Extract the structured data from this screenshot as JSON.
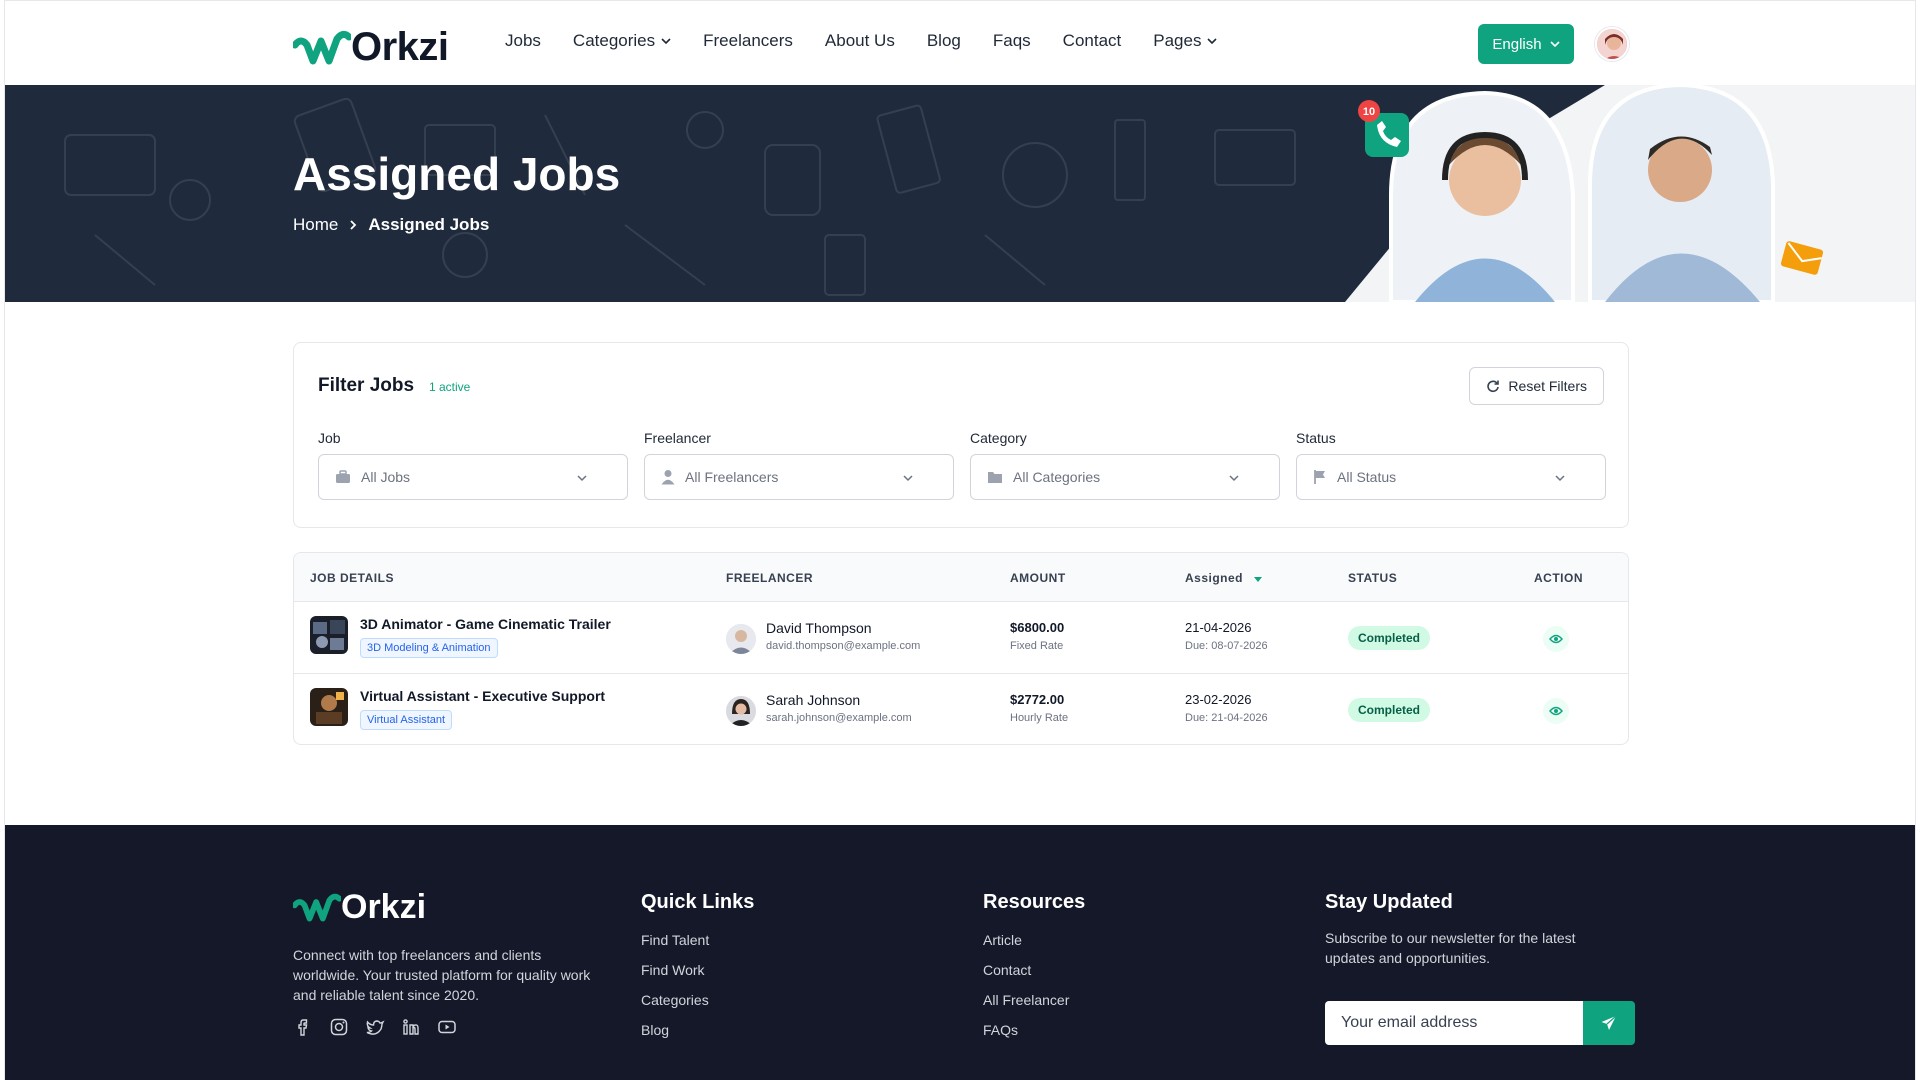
{
  "brand": {
    "logo_text": "Orkzi",
    "accent": "#10a37f",
    "dark_bg": "#1f2a3c",
    "footer_bg": "#141829"
  },
  "nav": {
    "items": [
      {
        "label": "Jobs",
        "dropdown": false
      },
      {
        "label": "Categories",
        "dropdown": true
      },
      {
        "label": "Freelancers",
        "dropdown": false
      },
      {
        "label": "About Us",
        "dropdown": false
      },
      {
        "label": "Blog",
        "dropdown": false
      },
      {
        "label": "Faqs",
        "dropdown": false
      },
      {
        "label": "Contact",
        "dropdown": false
      },
      {
        "label": "Pages",
        "dropdown": true
      }
    ],
    "language": "English"
  },
  "hero": {
    "title": "Assigned Jobs",
    "breadcrumb": {
      "home": "Home",
      "current": "Assigned Jobs"
    },
    "notification_count": "10"
  },
  "filters": {
    "title": "Filter Jobs",
    "active_count": "1 active",
    "reset_label": "Reset Filters",
    "fields": [
      {
        "label": "Job",
        "value": "All Jobs",
        "icon": "briefcase-icon"
      },
      {
        "label": "Freelancer",
        "value": "All Freelancers",
        "icon": "user-icon"
      },
      {
        "label": "Category",
        "value": "All Categories",
        "icon": "folder-icon"
      },
      {
        "label": "Status",
        "value": "All Status",
        "icon": "flag-icon"
      }
    ]
  },
  "table": {
    "headers": {
      "job": "JOB DETAILS",
      "freelancer": "FREELANCER",
      "amount": "AMOUNT",
      "assigned": "Assigned",
      "status": "STATUS",
      "action": "ACTION"
    },
    "rows": [
      {
        "title": "3D Animator - Game Cinematic Trailer",
        "tag": "3D Modeling & Animation",
        "freelancer": "David Thompson",
        "email": "david.thompson@example.com",
        "amount": "$6800.00",
        "rate": "Fixed Rate",
        "date": "21-04-2026",
        "due": "Due: 08-07-2026",
        "status": "Completed"
      },
      {
        "title": "Virtual Assistant - Executive Support",
        "tag": "Virtual Assistant",
        "freelancer": "Sarah Johnson",
        "email": "sarah.johnson@example.com",
        "amount": "$2772.00",
        "rate": "Hourly Rate",
        "date": "23-02-2026",
        "due": "Due: 21-04-2026",
        "status": "Completed"
      }
    ]
  },
  "footer": {
    "about": "Connect with top freelancers and clients worldwide. Your trusted platform for quality work and reliable talent since 2020.",
    "socials": [
      "facebook-icon",
      "instagram-icon",
      "twitter-icon",
      "linkedin-icon",
      "youtube-icon"
    ],
    "quick_links": {
      "title": "Quick Links",
      "links": [
        "Find Talent",
        "Find Work",
        "Categories",
        "Blog"
      ]
    },
    "resources": {
      "title": "Resources",
      "links": [
        "Article",
        "Contact",
        "All Freelancer",
        "FAQs"
      ]
    },
    "newsletter": {
      "title": "Stay Updated",
      "text": "Subscribe to our newsletter for the latest updates and opportunities.",
      "placeholder": "Your email address"
    }
  }
}
